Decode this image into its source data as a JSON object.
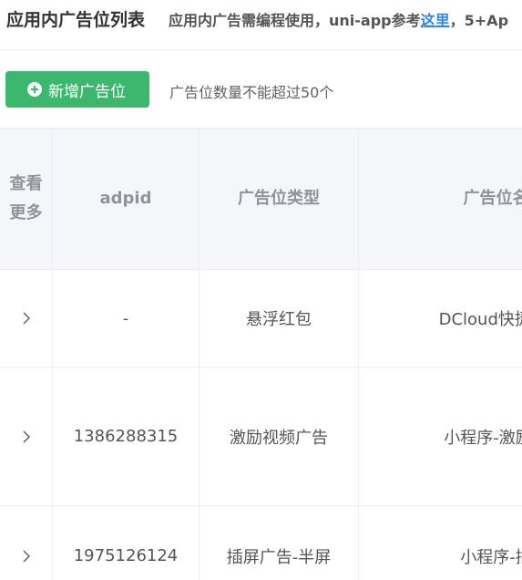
{
  "header": {
    "title": "应用内广告位列表",
    "description_prefix": "应用内广告需编程使用，uni-app参考",
    "link_label": "这里",
    "description_suffix": "，5+Ap"
  },
  "toolbar": {
    "add_label": "新增广告位",
    "limit_note": "广告位数量不能超过50个"
  },
  "table": {
    "columns": {
      "more": "查看\n更多",
      "adpid": "adpid",
      "type": "广告位类型",
      "name": "广告位名称"
    },
    "rows": [
      {
        "adpid": "-",
        "type": "悬浮红包",
        "name": "DCloud快捷广告-"
      },
      {
        "adpid": "1386288315",
        "type": "激励视频广告",
        "name": "小程序-激励视频"
      },
      {
        "adpid": "1975126124",
        "type": "插屏广告-半屏",
        "name": "小程序-插屏"
      }
    ]
  },
  "colors": {
    "accent_green": "#3cb76e",
    "link_blue": "#2f85e8",
    "header_bg": "#f5f6f9"
  },
  "icons": [
    "plus-circle-icon",
    "chevron-right-icon"
  ]
}
